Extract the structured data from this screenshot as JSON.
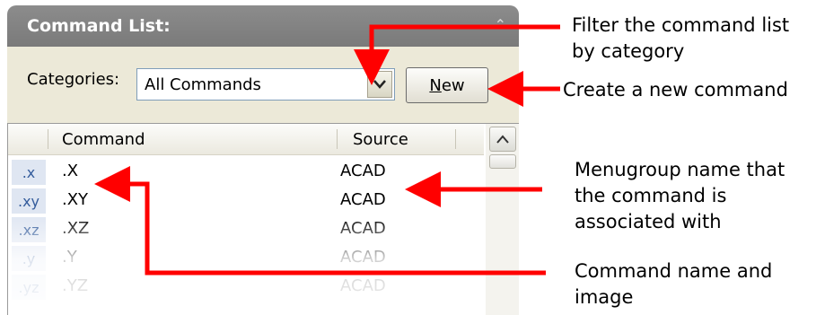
{
  "panel": {
    "title": "Command List:",
    "categories_label": "Categories:",
    "categories_selected": "All Commands",
    "new_button_label": "New",
    "columns": {
      "command": "Command",
      "source": "Source"
    },
    "rows": [
      {
        "icon_text": ".x",
        "command": ".X",
        "source": "ACAD"
      },
      {
        "icon_text": ".xy",
        "command": ".XY",
        "source": "ACAD"
      },
      {
        "icon_text": ".xz",
        "command": ".XZ",
        "source": "ACAD"
      },
      {
        "icon_text": ".y",
        "command": ".Y",
        "source": "ACAD"
      },
      {
        "icon_text": ".yz",
        "command": ".YZ",
        "source": "ACAD"
      }
    ]
  },
  "callouts": {
    "filter": [
      "Filter the command list",
      "by category"
    ],
    "create": [
      "Create a new command"
    ],
    "menugroup": [
      "Menugroup name that",
      "the command is",
      "associated with"
    ],
    "command_name": [
      "Command name and",
      "image"
    ]
  },
  "colors": {
    "arrow": "#ff0000",
    "title_bar": "#858585",
    "panel_bg": "#ece9d8"
  }
}
